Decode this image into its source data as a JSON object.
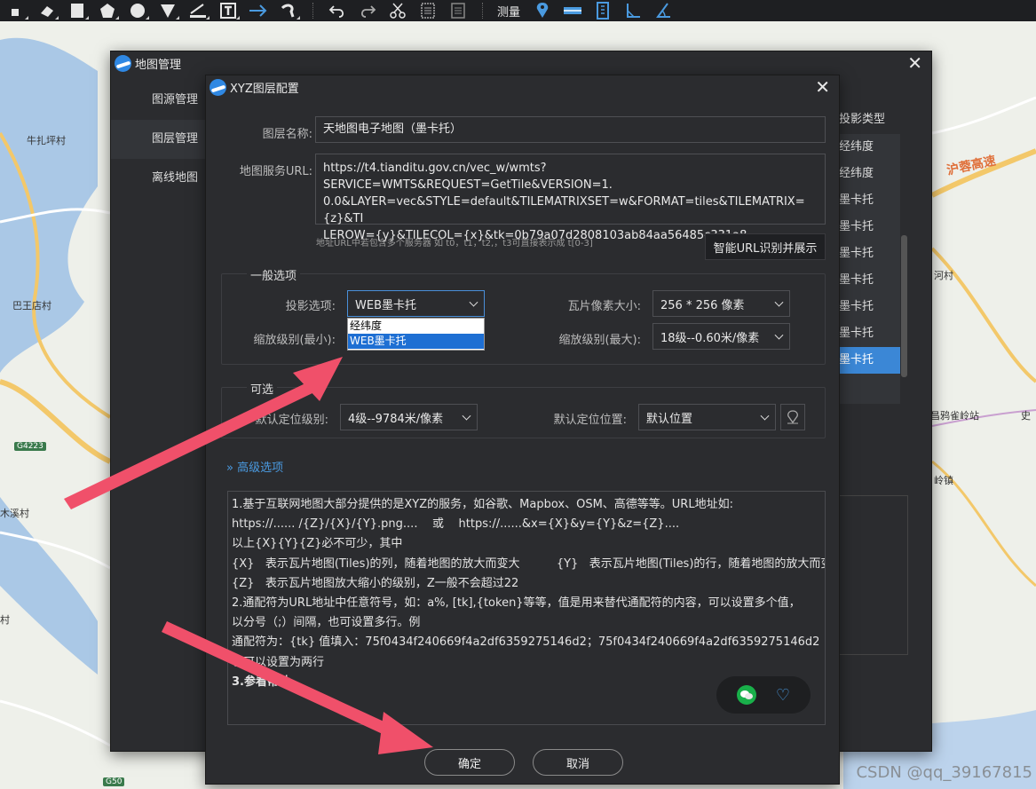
{
  "toolbar": {
    "measure_label": "测量"
  },
  "map": {
    "labels": {
      "niuzhaping": "牛扎坪村",
      "bawangdian": "巴王店村",
      "muxicun": "木溪村",
      "cun_left": "村",
      "hurong": "沪蓉高速",
      "hecun": "河村",
      "yayazhan": "昌鸦雀岭站",
      "shi": "史",
      "lingzhen": "岭镇",
      "g4223": "G4223",
      "g50": "G50"
    }
  },
  "map_manager": {
    "title": "地图管理",
    "side_items": [
      "图源管理",
      "图层管理",
      "离线地图"
    ],
    "column_header": "投影类型",
    "column_values": [
      "经纬度",
      "经纬度",
      "墨卡托",
      "墨卡托",
      "墨卡托",
      "墨卡托",
      "墨卡托",
      "墨卡托",
      "墨卡托"
    ]
  },
  "xyz": {
    "title": "XYZ图层配置",
    "layer_name_label": "图层名称:",
    "layer_name_value": "天地图电子地图（墨卡托）",
    "url_label": "地图服务URL:",
    "url_lines": [
      "https://t4.tianditu.gov.cn/vec_w/wmts?SERVICE=WMTS&REQUEST=GetTile&VERSION=1.",
      "0.0&LAYER=vec&STYLE=default&TILEMATRIXSET=w&FORMAT=tiles&TILEMATRIX={z}&TI",
      "LEROW={y}&TILECOL={x}&tk=0b79a07d2808103ab84aa56485c331a8"
    ],
    "url_hint": "地址URL中若包含多个服务器 如 t0，t1，t2,，t3可直接表示成 t[0-3]",
    "smart_url_button": "智能URL识别并展示",
    "general_group_title": "一般选项",
    "projection_label": "投影选项:",
    "projection_value": "WEB墨卡托",
    "projection_options": [
      "经纬度",
      "WEB墨卡托"
    ],
    "tile_size_label": "瓦片像素大小:",
    "tile_size_value": "256 * 256 像素",
    "zoom_min_label": "缩放级别(最小):",
    "zoom_max_label": "缩放级别(最大):",
    "zoom_max_value": "18级--0.60米/像素",
    "optional_group_title": "可选",
    "default_zoom_label": "默认定位级别:",
    "default_zoom_value": "4级--9784米/像素",
    "default_pos_label": "默认定位位置:",
    "default_pos_value": "默认位置",
    "advanced_label": "» 高级选项",
    "help_lines": [
      "1.基于互联网地图大部分提供的是XYZ的服务，如谷歌、Mapbox、OSM、高德等等。URL地址如:",
      "https://...... /{Z}/{X}/{Y}.png....    或    https://......&x={X}&y={Y}&z={Z}....",
      "以上{X}{Y}{Z}必不可少，其中",
      "{X}   表示瓦片地图(Tiles)的列，随着地图的放大而变大          {Y}   表示瓦片地图(Tiles)的行，随着地图的放大而变大",
      "{Z}   表示瓦片地图放大缩小的级别，Z一般不会超过22",
      "2.通配符为URL地址中任意符号，如：a%, [tk],{token}等等，值是用来替代通配符的内容，可以设置多个值，",
      "以分号（;）间隔，也可设置多行。例",
      "通配符为：{tk} 值填入：75f0434f240669f4a2df6359275146d2；75f0434f240669f4a2df6359275146d2",
      "也可以设置为两行",
      "3.参看帮助"
    ],
    "ok_button": "确定",
    "cancel_button": "取消"
  },
  "watermark": "CSDN @qq_39167815",
  "colors": {
    "accent": "#3b87d6",
    "arrow": "#f0506a",
    "dialog_bg": "#2b2c2f",
    "toolbar_bg": "#1e1f22"
  }
}
